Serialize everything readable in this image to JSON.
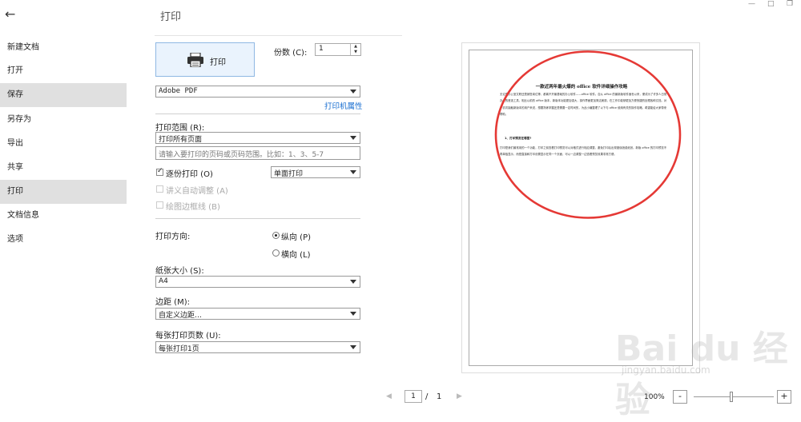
{
  "header": {
    "title": "打印"
  },
  "sidebar": {
    "items": [
      {
        "label": "新建文档"
      },
      {
        "label": "打开"
      },
      {
        "label": "保存"
      },
      {
        "label": "另存为"
      },
      {
        "label": "导出"
      },
      {
        "label": "共享"
      },
      {
        "label": "打印"
      },
      {
        "label": "文档信息"
      },
      {
        "label": "选项"
      }
    ]
  },
  "print": {
    "button_label": "打印",
    "copies_label": "份数 (C):",
    "copies_value": "1",
    "printer_value": "Adobe PDF",
    "printer_properties": "打印机属性",
    "range_label": "打印范围 (R):",
    "range_value": "打印所有页面",
    "pages_placeholder": "请输入要打印的页码或页码范围。比如：1、3、5-7",
    "collate_label": "逐份打印 (O)",
    "duplex_value": "单面打印",
    "lecture_label": "讲义自动调整 (A)",
    "draw_border_label": "绘图边框线 (B)",
    "orientation_label": "打印方向:",
    "portrait_label": "纵向 (P)",
    "landscape_label": "横向 (L)",
    "paper_label": "纸张大小 (S):",
    "paper_value": "A4",
    "margin_label": "边距 (M):",
    "margin_value": "自定义边距…",
    "per_page_label": "每张打印页数 (U):",
    "per_page_value": "每张打印1页"
  },
  "preview": {
    "doc_title": "一款近两年最火爆的 office 软件详细操作攻略",
    "paragraph1": "无论是办公室文职还是销售岗位等，都离不开最基础的办公软件——office 软件。自从 office 的最新版软件面世以来，便成为了许多人日常办公的首选工具，相比以前的 office 版本，新版本功能更加强大，操作界面更加简洁美观，在工作中能够更加方便快捷的处理各种文档。对于初次接触新版本的用户来说，想要熟练掌握还是需要一定时间的，为此小编整理了以下与 office 使用有关的操作攻略，希望能给大家带来帮助。",
    "subheading": "1、打印预览在哪里?",
    "paragraph2": "打印是我们最常用的一个功能，打印之前查看打印预览可以对格式进行相应调整，避免打印后出现错误浪费纸张。新版 office 的打印预览不再单独显示，而是直接和打印设置显示在同一个页面，可以一边调整一边查看预览效果非常方便。"
  },
  "pager": {
    "current": "1",
    "separator": "/",
    "total": "1"
  },
  "zoom": {
    "value": "100%",
    "minus": "-",
    "plus": "+",
    "level": 0.47
  },
  "watermark": {
    "main": "Bai du 经验",
    "sub": "jingyan.baidu.com"
  },
  "colors": {
    "accent": "#1a6fd0",
    "annotation": "#e53935"
  }
}
